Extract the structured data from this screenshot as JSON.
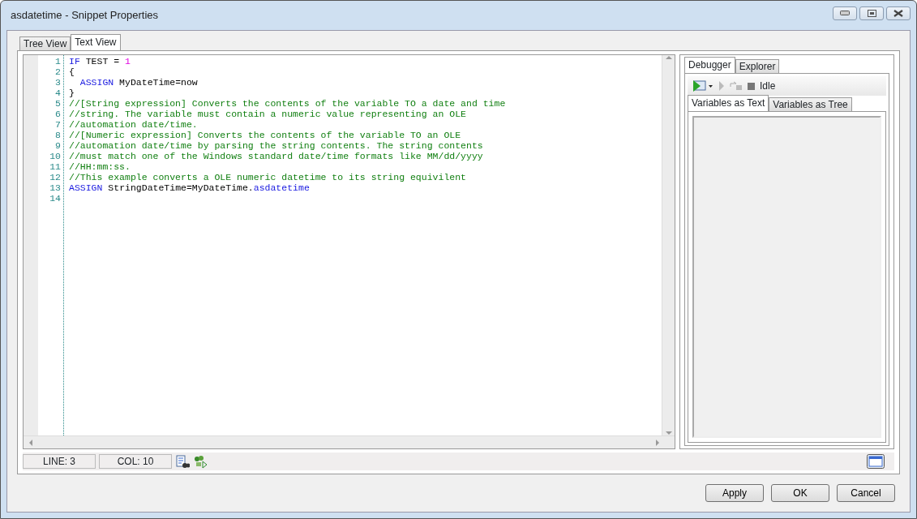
{
  "window": {
    "title": "asdatetime - Snippet Properties"
  },
  "tabs": [
    {
      "label": "Tree View",
      "selected": false
    },
    {
      "label": "Text View",
      "selected": true
    }
  ],
  "editor": {
    "lines": [
      {
        "number": "1",
        "segments": [
          {
            "kind": "keyword",
            "text": "IF"
          },
          {
            "kind": "plain",
            "text": " TEST = "
          },
          {
            "kind": "number",
            "text": "1"
          }
        ]
      },
      {
        "number": "2",
        "segments": [
          {
            "kind": "plain",
            "text": "{"
          }
        ]
      },
      {
        "number": "3",
        "indented": true,
        "segments": [
          {
            "kind": "keyword",
            "text": "ASSIGN"
          },
          {
            "kind": "plain",
            "text": " MyDateTime=now"
          }
        ]
      },
      {
        "number": "4",
        "segments": [
          {
            "kind": "plain",
            "text": "}"
          }
        ]
      },
      {
        "number": "5",
        "segments": [
          {
            "kind": "comment",
            "text": "//[String expression] Converts the contents of the variable TO a date and time"
          }
        ]
      },
      {
        "number": "6",
        "segments": [
          {
            "kind": "comment",
            "text": "//string. The variable must contain a numeric value representing an OLE"
          }
        ]
      },
      {
        "number": "7",
        "segments": [
          {
            "kind": "comment",
            "text": "//automation date/time."
          }
        ]
      },
      {
        "number": "8",
        "segments": [
          {
            "kind": "comment",
            "text": "//[Numeric expression] Converts the contents of the variable TO an OLE"
          }
        ]
      },
      {
        "number": "9",
        "segments": [
          {
            "kind": "comment",
            "text": "//automation date/time by parsing the string contents. The string contents"
          }
        ]
      },
      {
        "number": "10",
        "segments": [
          {
            "kind": "comment",
            "text": "//must match one of the Windows standard date/time formats like MM/dd/yyyy"
          }
        ]
      },
      {
        "number": "11",
        "segments": [
          {
            "kind": "comment",
            "text": "//HH:mm:ss."
          }
        ]
      },
      {
        "number": "12",
        "segments": [
          {
            "kind": "comment",
            "text": "//This example converts a OLE numeric datetime to its string equivilent"
          }
        ]
      },
      {
        "number": "13",
        "segments": [
          {
            "kind": "keyword",
            "text": "ASSIGN"
          },
          {
            "kind": "plain",
            "text": " StringDateTime=MyDateTime."
          },
          {
            "kind": "keyword",
            "text": "asdatetime"
          }
        ]
      },
      {
        "number": "14"
      }
    ]
  },
  "status_bar": {
    "line": "LINE: 3",
    "col": "COL: 10"
  },
  "side_tabs": [
    {
      "label": "Debugger",
      "selected": true
    },
    {
      "label": "Explorer",
      "selected": false
    }
  ],
  "debugger": {
    "state": "Idle",
    "var_tabs": [
      {
        "label": "Variables as Text",
        "selected": true
      },
      {
        "label": "Variables as Tree",
        "selected": false
      }
    ]
  },
  "buttons": [
    "Apply",
    "OK",
    "Cancel"
  ]
}
